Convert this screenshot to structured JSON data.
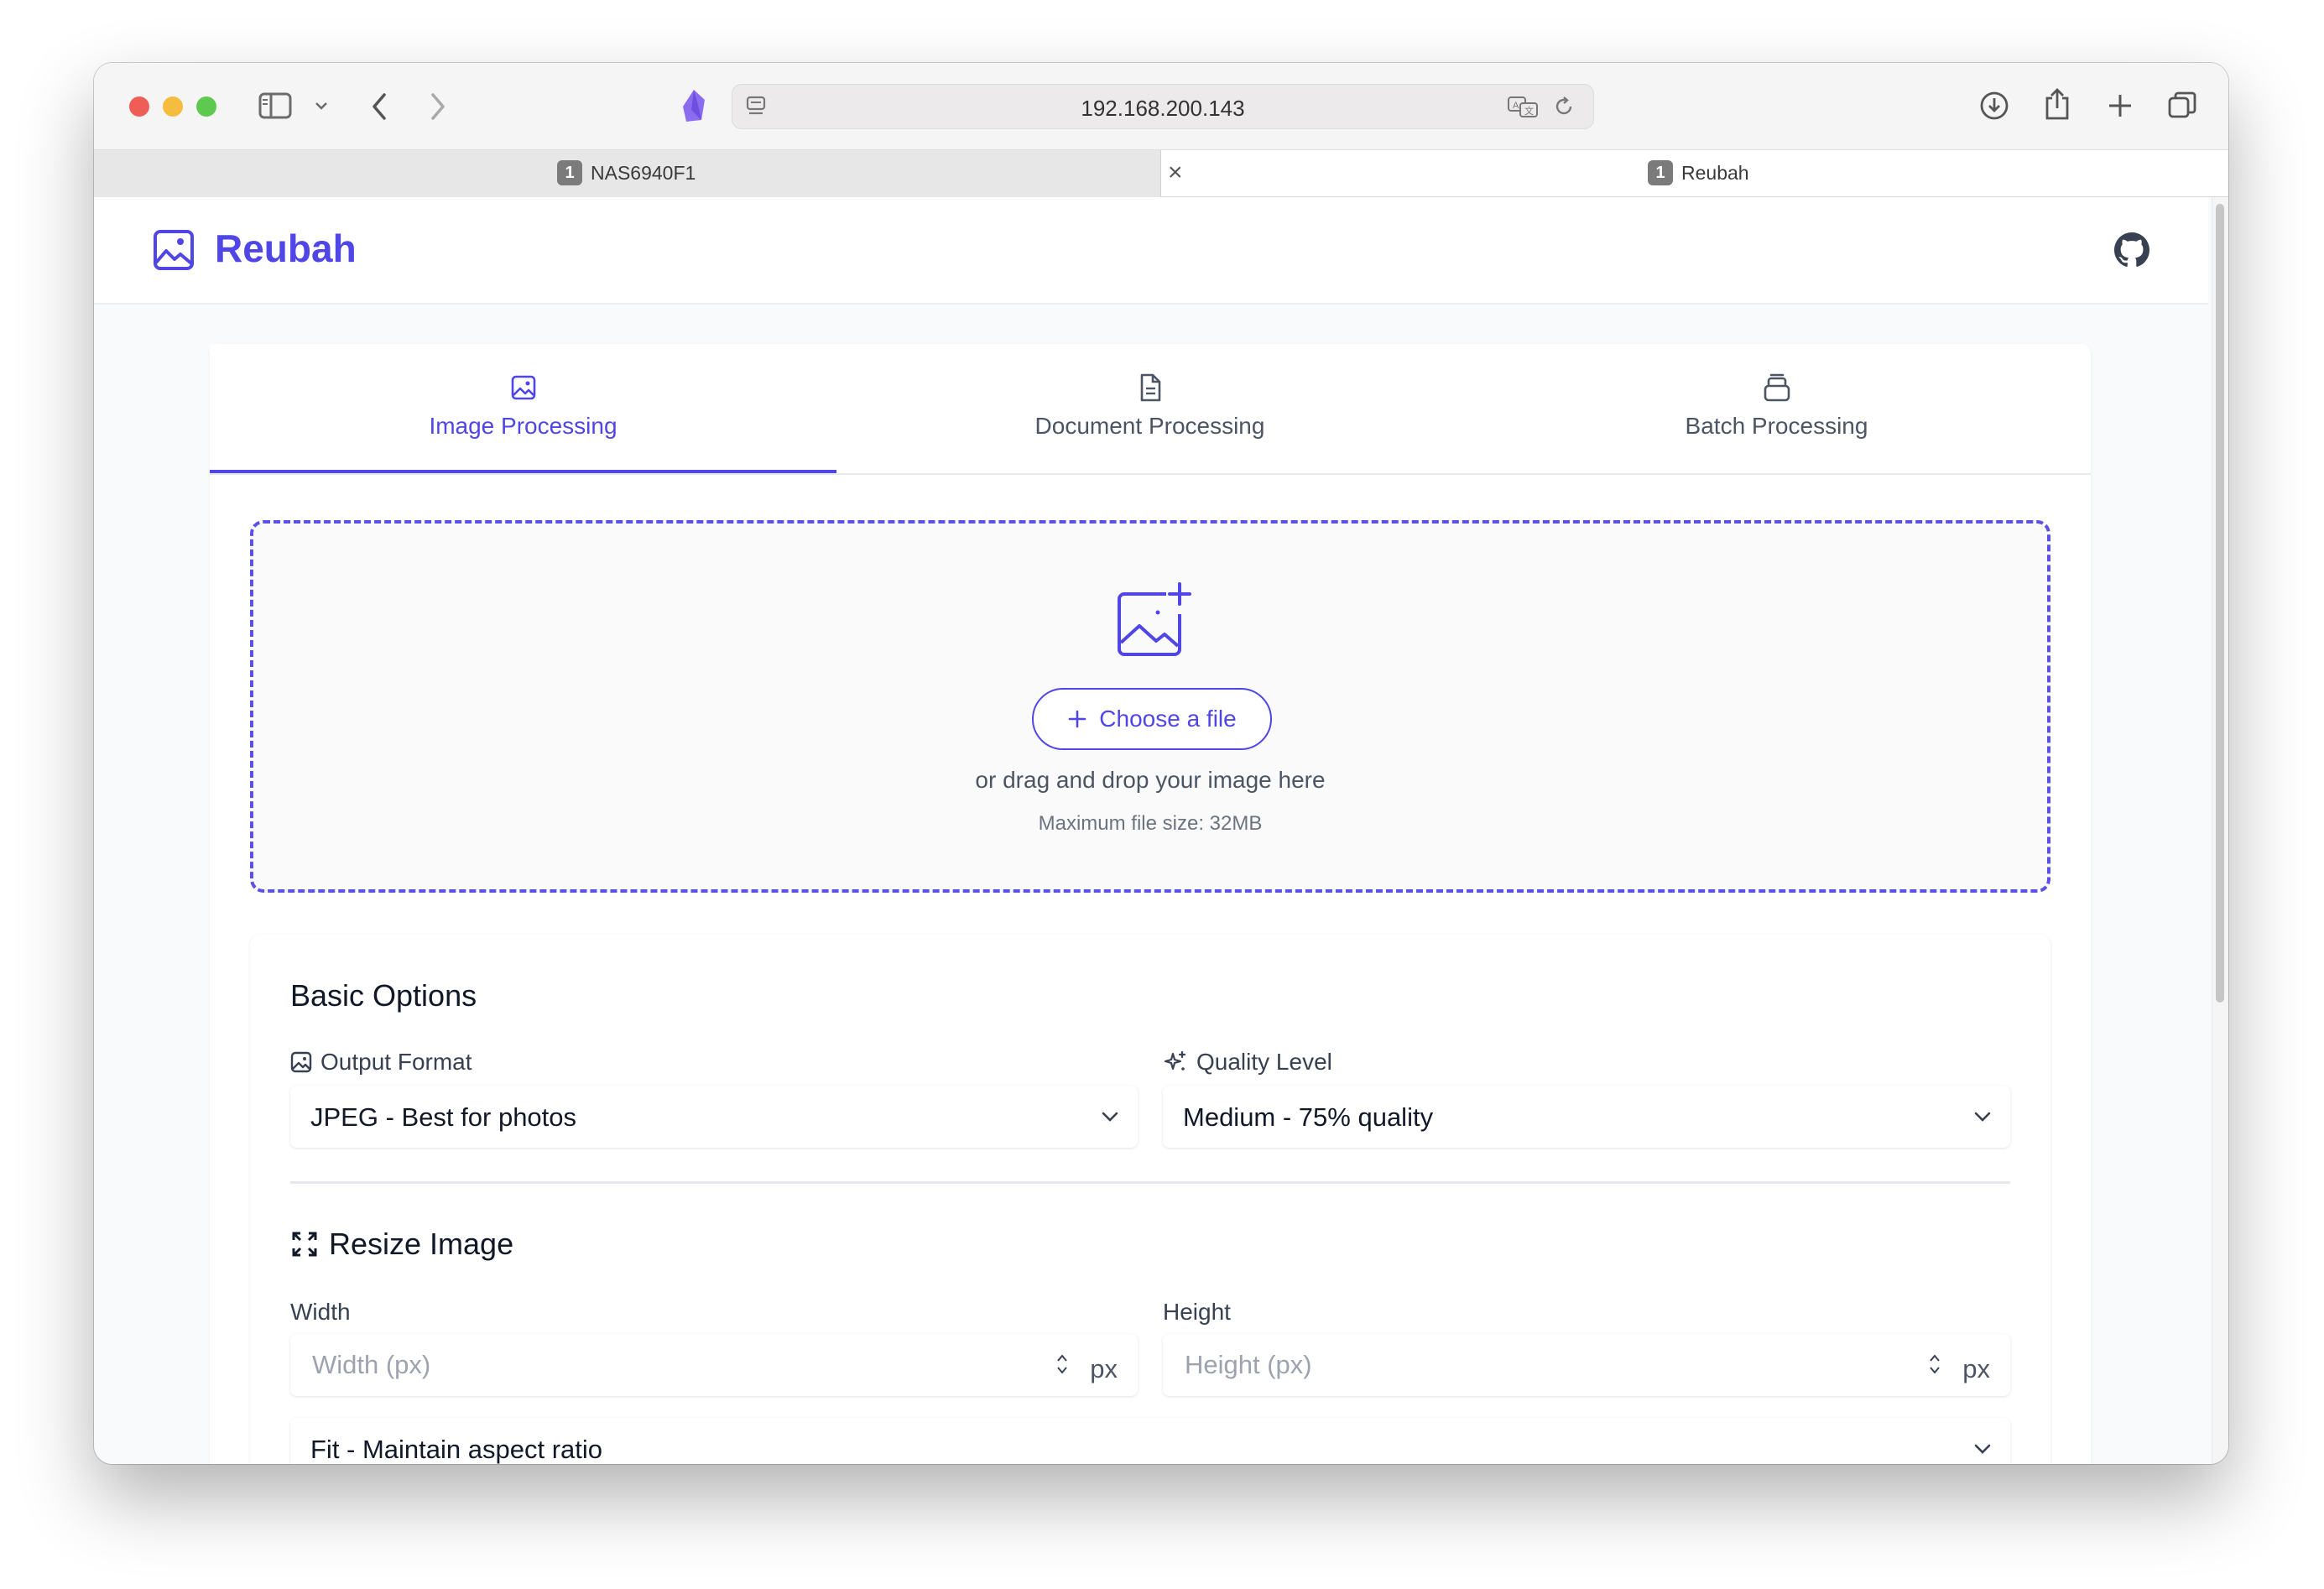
{
  "browser": {
    "url": "192.168.200.143",
    "tabs": [
      {
        "number": "1",
        "title": "NAS6940F1"
      },
      {
        "number": "1",
        "title": "Reubah"
      }
    ],
    "tab_close": "×"
  },
  "app": {
    "name": "Reubah",
    "brand_color": "#4f46e5",
    "tabs": [
      {
        "label": "Image Processing",
        "icon": "image-icon",
        "active": true
      },
      {
        "label": "Document Processing",
        "icon": "document-icon",
        "active": false
      },
      {
        "label": "Batch Processing",
        "icon": "stack-icon",
        "active": false
      }
    ]
  },
  "upload": {
    "button_label": "Choose a file",
    "hint": "or drag and drop your image here",
    "max_size": "Maximum file size: 32MB"
  },
  "basic_options": {
    "title": "Basic Options",
    "output_format_label": "Output Format",
    "output_format_value": "JPEG - Best for photos",
    "quality_label": "Quality Level",
    "quality_value": "Medium - 75% quality"
  },
  "resize": {
    "title": "Resize Image",
    "width_label": "Width",
    "width_placeholder": "Width (px)",
    "height_label": "Height",
    "height_placeholder": "Height (px)",
    "unit": "px",
    "mode_value": "Fit - Maintain aspect ratio"
  }
}
